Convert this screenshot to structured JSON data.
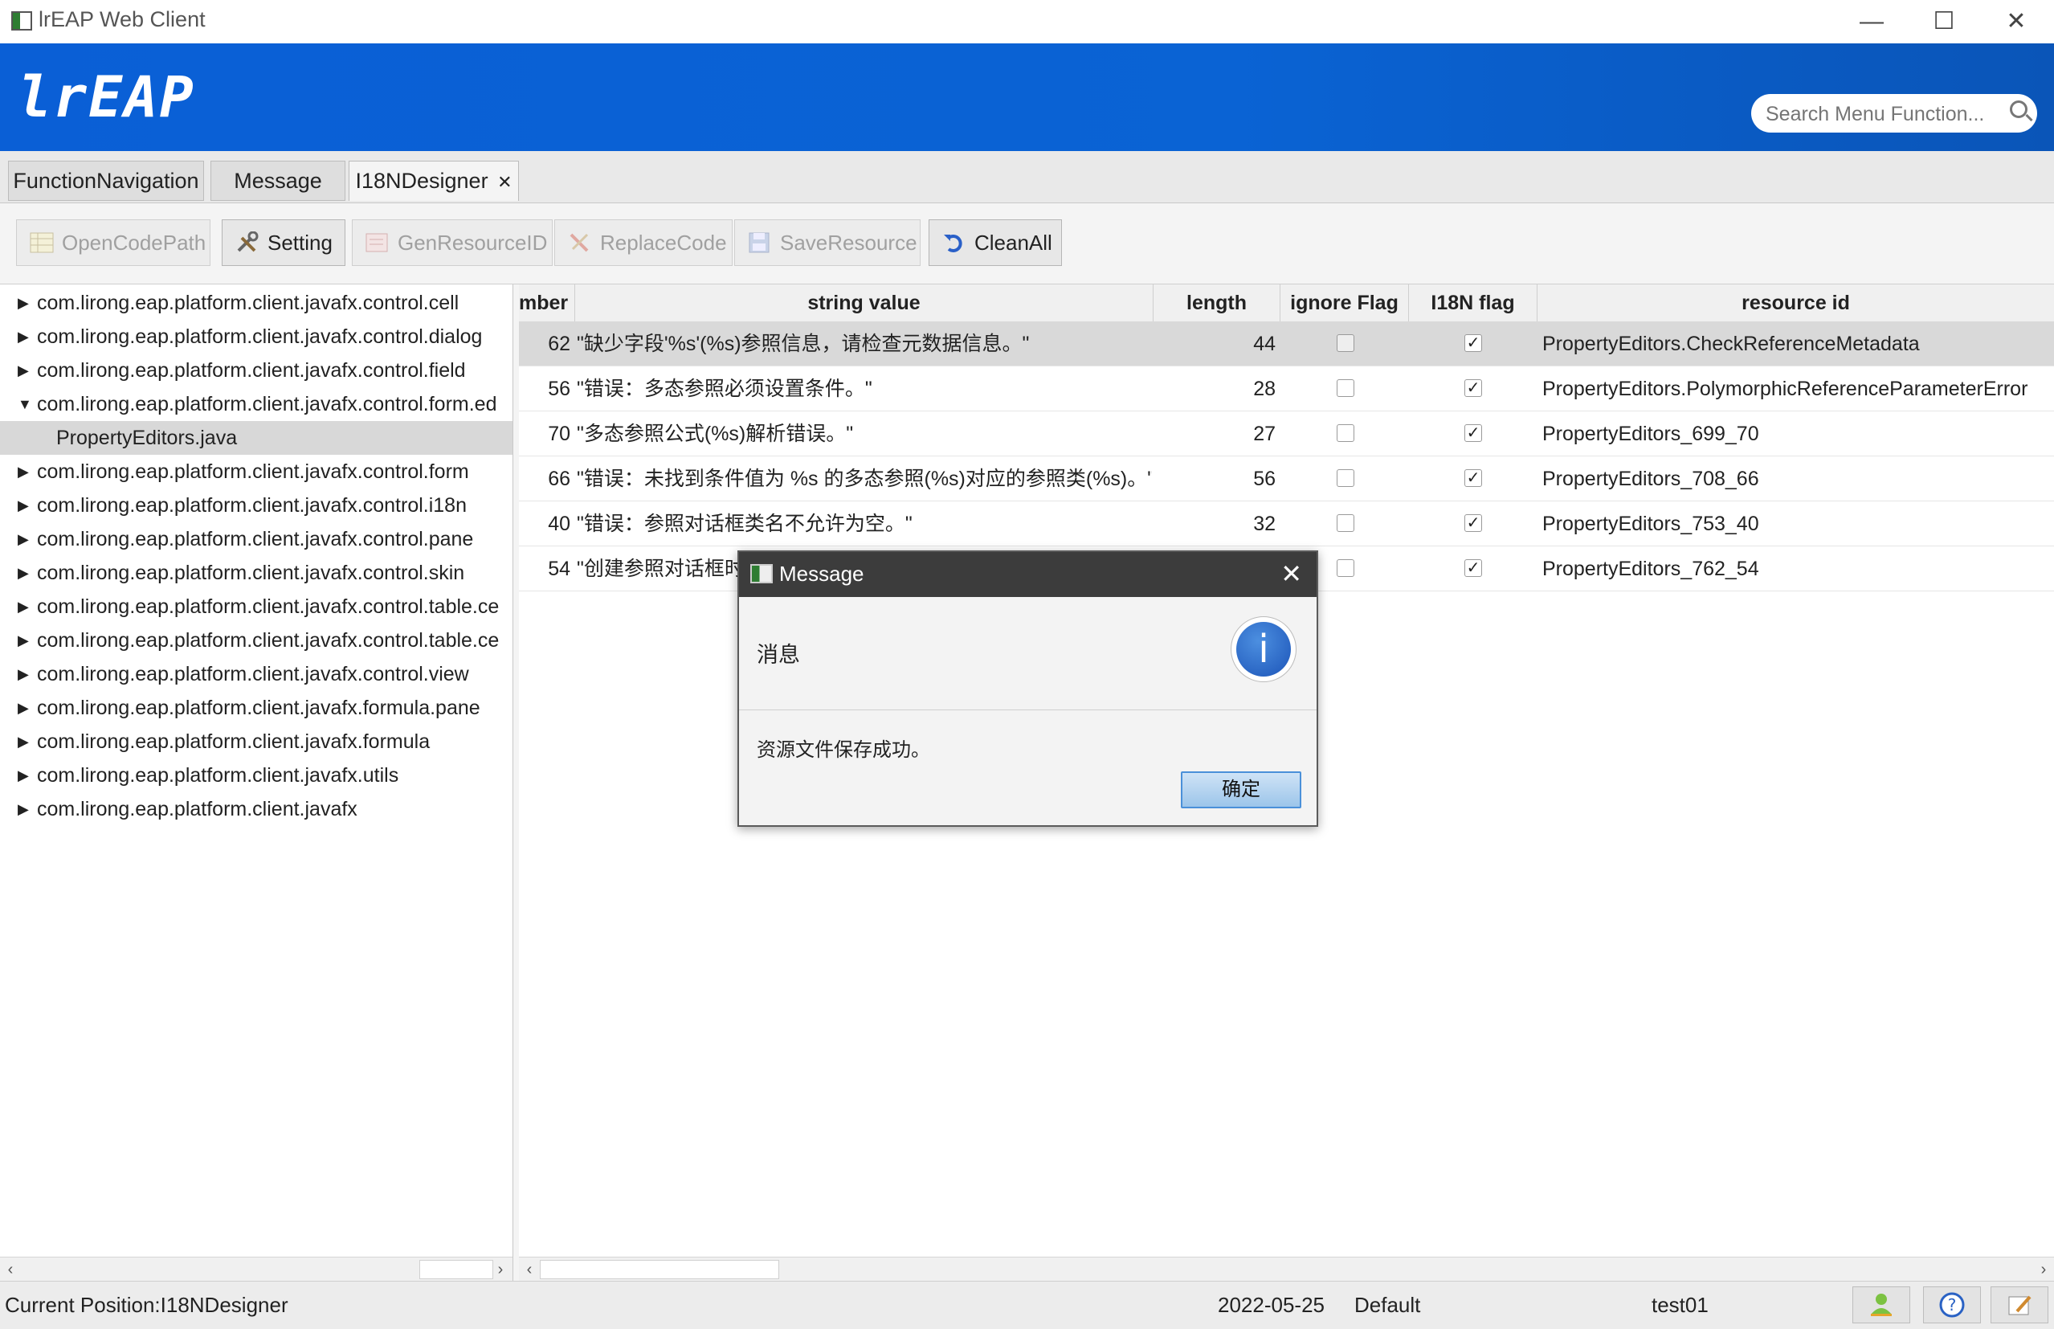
{
  "window": {
    "title": "lrEAP Web Client"
  },
  "header": {
    "logo": "lrEAP",
    "search_placeholder": "Search Menu Function..."
  },
  "tabs": [
    {
      "label": "FunctionNavigation"
    },
    {
      "label": "Message"
    },
    {
      "label": "I18NDesigner",
      "close": "✕"
    }
  ],
  "toolbar": {
    "open_code_path": "OpenCodePath",
    "setting": "Setting",
    "gen_resource_id": "GenResourceID",
    "replace_code": "ReplaceCode",
    "save_resource": "SaveResource",
    "clean_all": "CleanAll"
  },
  "tree": {
    "items": [
      "com.lirong.eap.platform.client.javafx.control.cell",
      "com.lirong.eap.platform.client.javafx.control.dialog",
      "com.lirong.eap.platform.client.javafx.control.field",
      "com.lirong.eap.platform.client.javafx.control.form.ed",
      "PropertyEditors.java",
      "com.lirong.eap.platform.client.javafx.control.form",
      "com.lirong.eap.platform.client.javafx.control.i18n",
      "com.lirong.eap.platform.client.javafx.control.pane",
      "com.lirong.eap.platform.client.javafx.control.skin",
      "com.lirong.eap.platform.client.javafx.control.table.ce",
      "com.lirong.eap.platform.client.javafx.control.table.ce",
      "com.lirong.eap.platform.client.javafx.control.view",
      "com.lirong.eap.platform.client.javafx.formula.pane",
      "com.lirong.eap.platform.client.javafx.formula",
      "com.lirong.eap.platform.client.javafx.utils",
      "com.lirong.eap.platform.client.javafx"
    ]
  },
  "table": {
    "columns": [
      "mber",
      "string value",
      "length",
      "ignore Flag",
      "I18N flag",
      "resource id"
    ],
    "rows": [
      {
        "number": "62",
        "string": "\"缺少字段'%s'(%s)参照信息，请检查元数据信息。\"",
        "length": "44",
        "ignore": false,
        "i18n": true,
        "resource": "PropertyEditors.CheckReferenceMetadata"
      },
      {
        "number": "56",
        "string": "\"错误：多态参照必须设置条件。\"",
        "length": "28",
        "ignore": false,
        "i18n": true,
        "resource": "PropertyEditors.PolymorphicReferenceParameterError"
      },
      {
        "number": "70",
        "string": "\"多态参照公式(%s)解析错误。\"",
        "length": "27",
        "ignore": false,
        "i18n": true,
        "resource": "PropertyEditors_699_70"
      },
      {
        "number": "66",
        "string": "\"错误：未找到条件值为 %s 的多态参照(%s)对应的参照类(%s)。\"",
        "length": "56",
        "ignore": false,
        "i18n": true,
        "resource": "PropertyEditors_708_66"
      },
      {
        "number": "40",
        "string": "\"错误：参照对话框类名不允许为空。\"",
        "length": "32",
        "ignore": false,
        "i18n": true,
        "resource": "PropertyEditors_753_40"
      },
      {
        "number": "54",
        "string": "\"创建参照对话框时",
        "length": "",
        "ignore": false,
        "i18n": true,
        "resource": "PropertyEditors_762_54"
      }
    ]
  },
  "dialog": {
    "title": "Message",
    "header": "消息",
    "info_glyph": "i",
    "body": "资源文件保存成功。",
    "ok": "确定"
  },
  "status": {
    "position": "Current Position:I18NDesigner",
    "date": "2022-05-25",
    "profile": "Default",
    "user": "test01"
  }
}
